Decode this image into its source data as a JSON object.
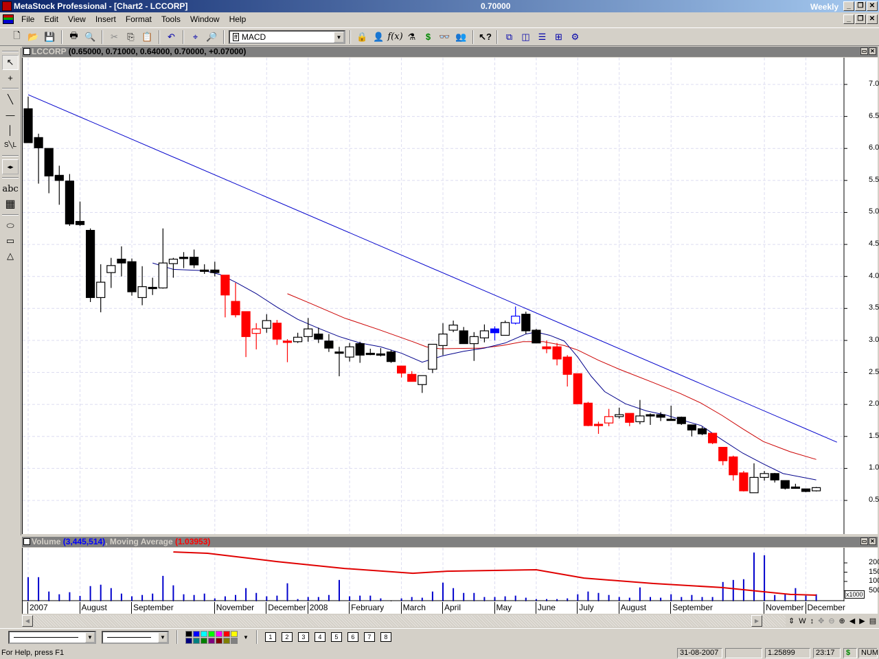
{
  "titlebar": {
    "title": "MetaStock Professional - [Chart2 - LCCORP]",
    "last_value": "0.70000",
    "periodicity": "Weekly"
  },
  "menu": [
    "File",
    "Edit",
    "View",
    "Insert",
    "Format",
    "Tools",
    "Window",
    "Help"
  ],
  "toolbar": {
    "indicator_select": "MACD"
  },
  "price_pane": {
    "symbol": "LCCORP",
    "ohlc": "(0.65000, 0.71000, 0.64000, 0.70000, +0.07000)"
  },
  "volume_pane": {
    "label": "Volume",
    "volume_value": "(3,445,514)",
    "ma_label": "Moving Average",
    "ma_value": "(1.03953)",
    "scale_label": "x1000"
  },
  "status": {
    "help": "For Help, press F1",
    "date": "31-08-2007",
    "value": "1.25899",
    "time": "23:17",
    "dollar": "$",
    "num": "NUM"
  },
  "colors": {
    "up": "#ffffff",
    "down": "#000000",
    "red": "#ff0000",
    "blue": "#0000ff",
    "ma_fast": "#00008b",
    "ma_slow": "#cc0000",
    "trend": "#0000cc",
    "volume": "#0000cc"
  },
  "chart_data": {
    "type": "candlestick",
    "price_ticks": [
      "0.5",
      "1.0",
      "1.5",
      "2.0",
      "2.5",
      "3.0",
      "3.5",
      "4.0",
      "4.5",
      "5.0",
      "5.5",
      "6.0",
      "6.5",
      "7.0"
    ],
    "ylim": [
      0.4,
      7.5
    ],
    "x_labels": [
      {
        "label": "2007",
        "i": 0
      },
      {
        "label": "August",
        "i": 5
      },
      {
        "label": "September",
        "i": 10
      },
      {
        "label": "November",
        "i": 18
      },
      {
        "label": "December",
        "i": 23
      },
      {
        "label": "2008",
        "i": 27
      },
      {
        "label": "February",
        "i": 31
      },
      {
        "label": "March",
        "i": 36
      },
      {
        "label": "April",
        "i": 40
      },
      {
        "label": "May",
        "i": 45
      },
      {
        "label": "June",
        "i": 49
      },
      {
        "label": "July",
        "i": 53
      },
      {
        "label": "August",
        "i": 57
      },
      {
        "label": "September",
        "i": 62
      },
      {
        "label": "November",
        "i": 71
      },
      {
        "label": "December",
        "i": 75
      }
    ],
    "candles": [
      [
        6.62,
        6.81,
        6.09,
        6.09,
        "k"
      ],
      [
        6.17,
        6.23,
        5.45,
        6.01,
        "k"
      ],
      [
        6.0,
        6.0,
        5.3,
        5.57,
        "k"
      ],
      [
        5.58,
        5.73,
        5.12,
        5.5,
        "k"
      ],
      [
        5.49,
        5.6,
        4.79,
        4.82,
        "k"
      ],
      [
        4.86,
        5.17,
        4.79,
        4.81,
        "k"
      ],
      [
        4.72,
        4.75,
        3.6,
        3.67,
        "k"
      ],
      [
        3.67,
        4.19,
        3.44,
        3.91,
        "w"
      ],
      [
        4.06,
        4.29,
        3.82,
        4.17,
        "w"
      ],
      [
        4.27,
        4.47,
        4.0,
        4.21,
        "k"
      ],
      [
        4.23,
        4.28,
        3.7,
        3.76,
        "k"
      ],
      [
        3.67,
        4.16,
        3.55,
        3.84,
        "w"
      ],
      [
        3.83,
        3.98,
        3.71,
        3.83,
        "k"
      ],
      [
        3.82,
        4.75,
        3.81,
        4.21,
        "w"
      ],
      [
        4.2,
        4.29,
        3.98,
        4.27,
        "w"
      ],
      [
        4.3,
        4.38,
        4.13,
        4.28,
        "k"
      ],
      [
        4.3,
        4.42,
        4.13,
        4.18,
        "k"
      ],
      [
        4.1,
        4.19,
        4.04,
        4.09,
        "k"
      ],
      [
        4.1,
        4.23,
        4.0,
        4.06,
        "k"
      ],
      [
        4.02,
        4.02,
        3.36,
        3.71,
        "r"
      ],
      [
        3.61,
        3.9,
        3.36,
        3.4,
        "r"
      ],
      [
        3.45,
        3.45,
        2.74,
        3.06,
        "r"
      ],
      [
        3.11,
        3.27,
        2.86,
        3.18,
        "rw"
      ],
      [
        3.19,
        3.41,
        3.12,
        3.31,
        "w"
      ],
      [
        3.27,
        3.32,
        2.93,
        3.02,
        "r"
      ],
      [
        2.99,
        3.02,
        2.66,
        2.97,
        "r"
      ],
      [
        2.98,
        3.12,
        2.96,
        3.05,
        "w"
      ],
      [
        3.06,
        3.35,
        2.98,
        3.18,
        "w"
      ],
      [
        3.1,
        3.2,
        2.96,
        3.02,
        "k"
      ],
      [
        2.99,
        3.1,
        2.82,
        2.88,
        "k"
      ],
      [
        2.82,
        2.9,
        2.44,
        2.81,
        "k"
      ],
      [
        2.74,
        2.96,
        2.67,
        2.9,
        "w"
      ],
      [
        2.95,
        2.98,
        2.65,
        2.77,
        "k"
      ],
      [
        2.8,
        2.87,
        2.77,
        2.79,
        "k"
      ],
      [
        2.79,
        2.88,
        2.75,
        2.79,
        "k"
      ],
      [
        2.82,
        2.85,
        2.65,
        2.67,
        "k"
      ],
      [
        2.6,
        2.6,
        2.42,
        2.49,
        "r"
      ],
      [
        2.47,
        2.52,
        2.36,
        2.36,
        "r"
      ],
      [
        2.31,
        2.45,
        2.18,
        2.45,
        "w"
      ],
      [
        2.55,
        2.94,
        2.49,
        2.94,
        "w"
      ],
      [
        2.92,
        3.27,
        2.77,
        3.1,
        "w"
      ],
      [
        3.16,
        3.31,
        3.13,
        3.24,
        "w"
      ],
      [
        3.15,
        3.21,
        2.95,
        2.95,
        "k"
      ],
      [
        2.95,
        3.13,
        2.68,
        3.06,
        "w"
      ],
      [
        3.04,
        3.25,
        2.97,
        3.15,
        "w"
      ],
      [
        3.12,
        3.22,
        3.0,
        3.18,
        "b"
      ],
      [
        3.08,
        3.31,
        3.08,
        3.28,
        "w"
      ],
      [
        3.27,
        3.53,
        3.25,
        3.38,
        "bw"
      ],
      [
        3.41,
        3.45,
        3.1,
        3.15,
        "k"
      ],
      [
        3.16,
        3.18,
        2.96,
        2.96,
        "k"
      ],
      [
        2.9,
        3.0,
        2.8,
        2.87,
        "r"
      ],
      [
        2.9,
        2.96,
        2.61,
        2.71,
        "r"
      ],
      [
        2.74,
        2.77,
        2.28,
        2.47,
        "r"
      ],
      [
        2.48,
        2.48,
        2.01,
        2.01,
        "r"
      ],
      [
        2.02,
        2.04,
        1.66,
        1.67,
        "r"
      ],
      [
        1.69,
        1.73,
        1.54,
        1.68,
        "r"
      ],
      [
        1.71,
        1.93,
        1.66,
        1.81,
        "rw"
      ],
      [
        1.81,
        1.95,
        1.78,
        1.84,
        "w"
      ],
      [
        1.86,
        1.86,
        1.66,
        1.72,
        "r"
      ],
      [
        1.73,
        2.07,
        1.69,
        1.82,
        "w"
      ],
      [
        1.84,
        1.86,
        1.68,
        1.84,
        "k"
      ],
      [
        1.84,
        1.88,
        1.74,
        1.8,
        "k"
      ],
      [
        1.77,
        1.98,
        1.75,
        1.76,
        "k"
      ],
      [
        1.8,
        1.81,
        1.68,
        1.7,
        "k"
      ],
      [
        1.68,
        1.68,
        1.5,
        1.6,
        "k"
      ],
      [
        1.62,
        1.65,
        1.52,
        1.54,
        "k"
      ],
      [
        1.55,
        1.55,
        1.38,
        1.4,
        "r"
      ],
      [
        1.33,
        1.33,
        1.05,
        1.12,
        "r"
      ],
      [
        1.18,
        1.2,
        0.81,
        0.9,
        "r"
      ],
      [
        0.93,
        0.96,
        0.64,
        0.65,
        "r"
      ],
      [
        0.62,
        1.08,
        0.62,
        0.86,
        "w"
      ],
      [
        0.86,
        0.96,
        0.81,
        0.92,
        "w"
      ],
      [
        0.92,
        0.93,
        0.78,
        0.82,
        "k"
      ],
      [
        0.81,
        0.81,
        0.67,
        0.69,
        "k"
      ],
      [
        0.71,
        0.76,
        0.69,
        0.7,
        "k"
      ],
      [
        0.68,
        0.68,
        0.63,
        0.64,
        "k"
      ],
      [
        0.65,
        0.71,
        0.64,
        0.7,
        "w"
      ]
    ],
    "trendline": [
      [
        0,
        6.84
      ],
      [
        78,
        1.41
      ]
    ],
    "ma_fast": [
      [
        12,
        4.21
      ],
      [
        14,
        4.11
      ],
      [
        17,
        4.09
      ],
      [
        18.5,
        4.03
      ],
      [
        20,
        3.91
      ],
      [
        22,
        3.73
      ],
      [
        24,
        3.52
      ],
      [
        26,
        3.33
      ],
      [
        28,
        3.19
      ],
      [
        30,
        3.06
      ],
      [
        32,
        2.96
      ],
      [
        34,
        2.9
      ],
      [
        36,
        2.8
      ],
      [
        38,
        2.66
      ],
      [
        40,
        2.76
      ],
      [
        42,
        2.83
      ],
      [
        44,
        2.88
      ],
      [
        46,
        2.96
      ],
      [
        48,
        3.1
      ],
      [
        49,
        3.13
      ],
      [
        50.3,
        3.08
      ],
      [
        51.7,
        2.99
      ],
      [
        53,
        2.74
      ],
      [
        54.3,
        2.44
      ],
      [
        55.6,
        2.2
      ],
      [
        57.6,
        2.01
      ],
      [
        59.6,
        1.9
      ],
      [
        61.6,
        1.83
      ],
      [
        63.6,
        1.73
      ],
      [
        64.9,
        1.67
      ],
      [
        66.9,
        1.45
      ],
      [
        68.9,
        1.24
      ],
      [
        70.9,
        1.07
      ],
      [
        72.8,
        0.92
      ],
      [
        76,
        0.82
      ]
    ],
    "ma_slow": [
      [
        25,
        3.73
      ],
      [
        27.2,
        3.58
      ],
      [
        30.5,
        3.35
      ],
      [
        33.8,
        3.17
      ],
      [
        37.1,
        2.98
      ],
      [
        38.4,
        2.9
      ],
      [
        39.7,
        2.87
      ],
      [
        43.7,
        2.88
      ],
      [
        45.7,
        2.92
      ],
      [
        47.7,
        2.98
      ],
      [
        49.7,
        2.98
      ],
      [
        51.7,
        2.92
      ],
      [
        53,
        2.85
      ],
      [
        55,
        2.69
      ],
      [
        57,
        2.55
      ],
      [
        60.3,
        2.34
      ],
      [
        62.9,
        2.17
      ],
      [
        64.9,
        2.02
      ],
      [
        66.9,
        1.83
      ],
      [
        68.9,
        1.62
      ],
      [
        70.9,
        1.42
      ],
      [
        73.5,
        1.26
      ],
      [
        76,
        1.14
      ]
    ],
    "volume_ticks": [
      "5000",
      "10000",
      "15000",
      "20000"
    ],
    "volume": [
      12300,
      12300,
      4550,
      3075,
      4180,
      2200,
      7500,
      8240,
      6400,
      3440,
      1970,
      2700,
      3440,
      13000,
      7900,
      3075,
      2700,
      3440,
      860,
      1970,
      2700,
      6400,
      3800,
      1970,
      2340,
      9000,
      490,
      1600,
      1600,
      2700,
      10800,
      1970,
      2340,
      2340,
      860,
      0,
      860,
      1600,
      1230,
      4550,
      9350,
      6400,
      3800,
      3800,
      1600,
      1600,
      1970,
      2340,
      1230,
      490,
      490,
      490,
      860,
      3075,
      4550,
      3800,
      2700,
      1600,
      1230,
      6770,
      1600,
      1230,
      3075,
      1600,
      2700,
      1600,
      1600,
      9700,
      10800,
      11200,
      25600,
      24100,
      2700,
      3440,
      6400,
      2340,
      3075
    ],
    "volume_ma": [
      [
        14,
        25900
      ],
      [
        17.3,
        25200
      ],
      [
        24,
        20700
      ],
      [
        30.5,
        17000
      ],
      [
        37.1,
        14400
      ],
      [
        40.4,
        15500
      ],
      [
        49,
        16300
      ],
      [
        53.6,
        11800
      ],
      [
        60.3,
        8900
      ],
      [
        66.9,
        6700
      ],
      [
        73.5,
        3000
      ],
      [
        76,
        2600
      ]
    ]
  }
}
